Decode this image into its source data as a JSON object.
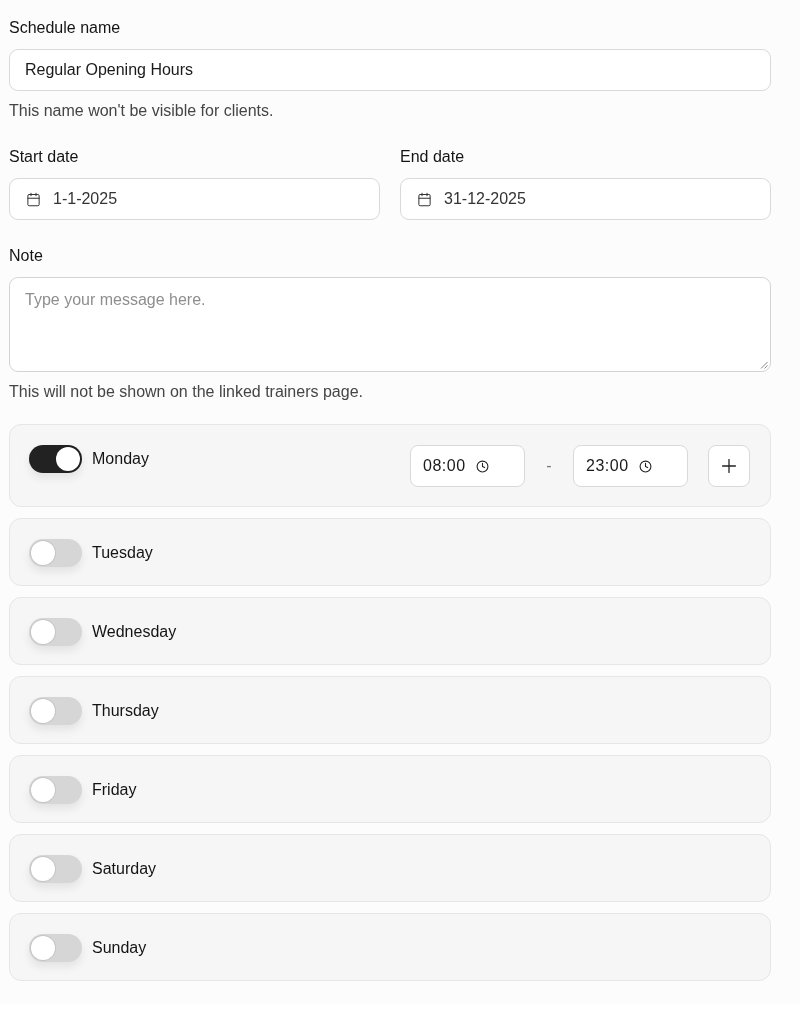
{
  "schedule_name": {
    "label": "Schedule name",
    "value": "Regular Opening Hours",
    "helper": "This name won't be visible for clients."
  },
  "dates": [
    {
      "label": "Start date",
      "value": "1-1-2025"
    },
    {
      "label": "End date",
      "value": "31-12-2025"
    }
  ],
  "note": {
    "label": "Note",
    "placeholder": "Type your message here.",
    "helper": "This will not be shown on the linked trainers page."
  },
  "days": [
    {
      "name": "Monday",
      "on": true,
      "slots": [
        {
          "start": "08:00",
          "separator": "-",
          "end": "23:00"
        }
      ]
    },
    {
      "name": "Tuesday",
      "on": false
    },
    {
      "name": "Wednesday",
      "on": false
    },
    {
      "name": "Thursday",
      "on": false
    },
    {
      "name": "Friday",
      "on": false
    },
    {
      "name": "Saturday",
      "on": false
    },
    {
      "name": "Sunday",
      "on": false
    }
  ]
}
